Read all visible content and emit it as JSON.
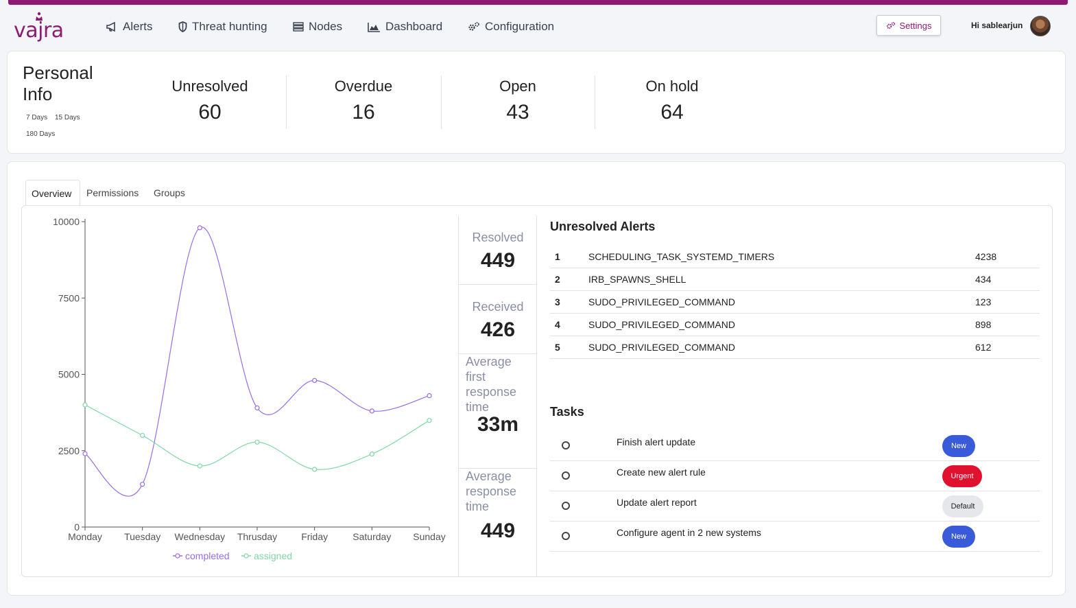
{
  "brand": {
    "logo_text": "vajra",
    "accent": "#8e1a74"
  },
  "nav": {
    "items": [
      {
        "label": "Alerts",
        "icon": "megaphone-icon"
      },
      {
        "label": "Threat hunting",
        "icon": "shield-icon"
      },
      {
        "label": "Nodes",
        "icon": "server-icon"
      },
      {
        "label": "Dashboard",
        "icon": "area-chart-icon"
      },
      {
        "label": "Configuration",
        "icon": "cogs-icon"
      }
    ],
    "settings_label": "Settings",
    "greeting": "Hi sablearjun"
  },
  "personal": {
    "title": "Personal Info",
    "ranges": [
      "7 Days",
      "15 Days",
      "180 Days"
    ],
    "stats": [
      {
        "label": "Unresolved",
        "value": "60"
      },
      {
        "label": "Overdue",
        "value": "16"
      },
      {
        "label": "Open",
        "value": "43"
      },
      {
        "label": "On hold",
        "value": "64"
      }
    ]
  },
  "tabs": [
    "Overview",
    "Permissions",
    "Groups"
  ],
  "metrics": [
    {
      "label": "Resolved",
      "value": "449"
    },
    {
      "label": "Received",
      "value": "426"
    },
    {
      "label": "Average first response time",
      "value": "33m"
    },
    {
      "label": "Average response time",
      "value": "449"
    }
  ],
  "unresolved": {
    "title": "Unresolved Alerts",
    "rows": [
      {
        "n": "1",
        "name": "SCHEDULING_TASK_SYSTEMD_TIMERS",
        "count": "4238"
      },
      {
        "n": "2",
        "name": "IRB_SPAWNS_SHELL",
        "count": "434"
      },
      {
        "n": "3",
        "name": "SUDO_PRIVILEGED_COMMAND",
        "count": "123"
      },
      {
        "n": "4",
        "name": "SUDO_PRIVILEGED_COMMAND",
        "count": "898"
      },
      {
        "n": "5",
        "name": "SUDO_PRIVILEGED_COMMAND",
        "count": "612"
      }
    ]
  },
  "tasks": {
    "title": "Tasks",
    "rows": [
      {
        "text": "Finish alert update",
        "badge": "New",
        "kind": "new"
      },
      {
        "text": "Create new alert rule",
        "badge": "Urgent",
        "kind": "urgent"
      },
      {
        "text": "Update alert report",
        "badge": "Default",
        "kind": "default"
      },
      {
        "text": "Configure agent in 2 new systems",
        "badge": "New",
        "kind": "new"
      }
    ]
  },
  "chart_data": {
    "type": "line",
    "categories": [
      "Monday",
      "Tuesday",
      "Wednesday",
      "Thrusday",
      "Friday",
      "Saturday",
      "Sunday"
    ],
    "series": [
      {
        "name": "completed",
        "color": "#9b6ce8",
        "values": [
          2400,
          1400,
          9800,
          3900,
          4800,
          3800,
          4300
        ]
      },
      {
        "name": "assigned",
        "color": "#7fd8a6",
        "values": [
          4000,
          3000,
          2000,
          2780,
          1890,
          2390,
          3490
        ]
      }
    ],
    "yticks": [
      0,
      2500,
      5000,
      7500,
      10000
    ],
    "ylim": [
      0,
      10000
    ],
    "grid": false,
    "legend": "bottom"
  }
}
